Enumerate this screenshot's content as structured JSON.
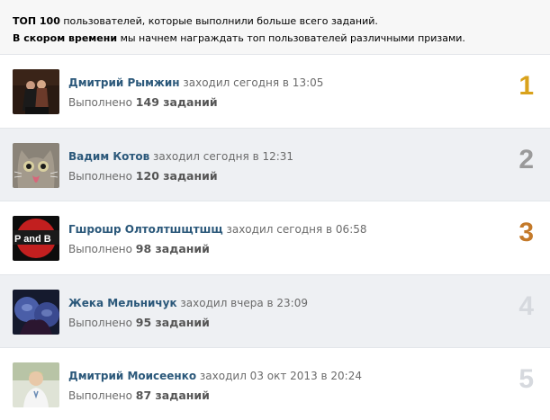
{
  "intro": {
    "line1_bold": "ТОП 100",
    "line1_rest": " пользователей, которые выполнили больше всего заданий.",
    "line2_bold": "В скором времени",
    "line2_rest": " мы начнем награждать топ пользователей различными призами."
  },
  "users": [
    {
      "name": "Дмитрий Рымжин",
      "last_seen": " заходил сегодня в 13:05",
      "done_label": "Выполнено ",
      "count": "149 заданий",
      "rank": "1",
      "rank_color": "#d9a21b"
    },
    {
      "name": "Вадим Котов",
      "last_seen": " заходил сегодня в 12:31",
      "done_label": "Выполнено ",
      "count": "120 заданий",
      "rank": "2",
      "rank_color": "#9a9a9a"
    },
    {
      "name": "Гшрошр Олтолтшщтшщ",
      "last_seen": " заходил сегодня в 06:58",
      "done_label": "Выполнено ",
      "count": "98 заданий",
      "rank": "3",
      "rank_color": "#c47a2a"
    },
    {
      "name": "Жека Мельничук",
      "last_seen": " заходил вчера в 23:09",
      "done_label": "Выполнено ",
      "count": "95 заданий",
      "rank": "4",
      "rank_color": "#d6d9de"
    },
    {
      "name": "Дмитрий Моисеенко",
      "last_seen": " заходил 03 окт 2013 в 20:24",
      "done_label": "Выполнено ",
      "count": "87 заданий",
      "rank": "5",
      "rank_color": "#d6d9de"
    }
  ],
  "avatar_text": {
    "user3": "P and B"
  }
}
